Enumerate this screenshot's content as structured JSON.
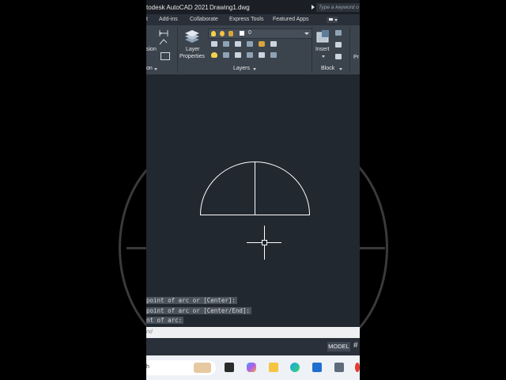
{
  "titlebar": {
    "title": "todesk AutoCAD 2021",
    "filename": "Drawing1.dwg",
    "search_placeholder": "Type a keyword o"
  },
  "tabs": [
    {
      "label": "t"
    },
    {
      "label": "Add-ins"
    },
    {
      "label": "Collaborate"
    },
    {
      "label": "Express Tools"
    },
    {
      "label": "Featured Apps"
    }
  ],
  "ribbon": {
    "partial_label_left": "sion",
    "partial_panel_left": "on",
    "layer_properties_line1": "Layer",
    "layer_properties_line2": "Properties",
    "layer_current": "0",
    "layers_panel": "Layers",
    "insert_label": "Insert",
    "block_panel": "Block",
    "partial_right": "Pr"
  },
  "command_history": [
    "point of arc or [Center]:",
    "point of arc or [Center/End]:",
    "nt of arc:"
  ],
  "command_input": "nd",
  "status": {
    "model": "MODEL",
    "grid_glyph": "#"
  },
  "taskbar": {
    "search_partial": "h"
  },
  "colors": {
    "canvas": "#212830",
    "ribbon": "#3b434d",
    "drawing": "#ffffff"
  }
}
